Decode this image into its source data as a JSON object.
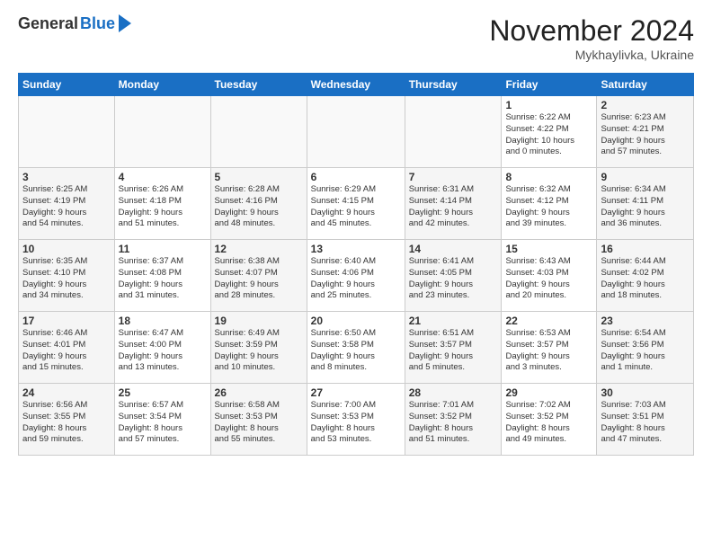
{
  "logo": {
    "general": "General",
    "blue": "Blue"
  },
  "header": {
    "title": "November 2024",
    "location": "Mykhaylivka, Ukraine"
  },
  "days": [
    "Sunday",
    "Monday",
    "Tuesday",
    "Wednesday",
    "Thursday",
    "Friday",
    "Saturday"
  ],
  "weeks": [
    [
      {
        "num": "",
        "info": ""
      },
      {
        "num": "",
        "info": ""
      },
      {
        "num": "",
        "info": ""
      },
      {
        "num": "",
        "info": ""
      },
      {
        "num": "",
        "info": ""
      },
      {
        "num": "1",
        "info": "Sunrise: 6:22 AM\nSunset: 4:22 PM\nDaylight: 10 hours\nand 0 minutes."
      },
      {
        "num": "2",
        "info": "Sunrise: 6:23 AM\nSunset: 4:21 PM\nDaylight: 9 hours\nand 57 minutes."
      }
    ],
    [
      {
        "num": "3",
        "info": "Sunrise: 6:25 AM\nSunset: 4:19 PM\nDaylight: 9 hours\nand 54 minutes."
      },
      {
        "num": "4",
        "info": "Sunrise: 6:26 AM\nSunset: 4:18 PM\nDaylight: 9 hours\nand 51 minutes."
      },
      {
        "num": "5",
        "info": "Sunrise: 6:28 AM\nSunset: 4:16 PM\nDaylight: 9 hours\nand 48 minutes."
      },
      {
        "num": "6",
        "info": "Sunrise: 6:29 AM\nSunset: 4:15 PM\nDaylight: 9 hours\nand 45 minutes."
      },
      {
        "num": "7",
        "info": "Sunrise: 6:31 AM\nSunset: 4:14 PM\nDaylight: 9 hours\nand 42 minutes."
      },
      {
        "num": "8",
        "info": "Sunrise: 6:32 AM\nSunset: 4:12 PM\nDaylight: 9 hours\nand 39 minutes."
      },
      {
        "num": "9",
        "info": "Sunrise: 6:34 AM\nSunset: 4:11 PM\nDaylight: 9 hours\nand 36 minutes."
      }
    ],
    [
      {
        "num": "10",
        "info": "Sunrise: 6:35 AM\nSunset: 4:10 PM\nDaylight: 9 hours\nand 34 minutes."
      },
      {
        "num": "11",
        "info": "Sunrise: 6:37 AM\nSunset: 4:08 PM\nDaylight: 9 hours\nand 31 minutes."
      },
      {
        "num": "12",
        "info": "Sunrise: 6:38 AM\nSunset: 4:07 PM\nDaylight: 9 hours\nand 28 minutes."
      },
      {
        "num": "13",
        "info": "Sunrise: 6:40 AM\nSunset: 4:06 PM\nDaylight: 9 hours\nand 25 minutes."
      },
      {
        "num": "14",
        "info": "Sunrise: 6:41 AM\nSunset: 4:05 PM\nDaylight: 9 hours\nand 23 minutes."
      },
      {
        "num": "15",
        "info": "Sunrise: 6:43 AM\nSunset: 4:03 PM\nDaylight: 9 hours\nand 20 minutes."
      },
      {
        "num": "16",
        "info": "Sunrise: 6:44 AM\nSunset: 4:02 PM\nDaylight: 9 hours\nand 18 minutes."
      }
    ],
    [
      {
        "num": "17",
        "info": "Sunrise: 6:46 AM\nSunset: 4:01 PM\nDaylight: 9 hours\nand 15 minutes."
      },
      {
        "num": "18",
        "info": "Sunrise: 6:47 AM\nSunset: 4:00 PM\nDaylight: 9 hours\nand 13 minutes."
      },
      {
        "num": "19",
        "info": "Sunrise: 6:49 AM\nSunset: 3:59 PM\nDaylight: 9 hours\nand 10 minutes."
      },
      {
        "num": "20",
        "info": "Sunrise: 6:50 AM\nSunset: 3:58 PM\nDaylight: 9 hours\nand 8 minutes."
      },
      {
        "num": "21",
        "info": "Sunrise: 6:51 AM\nSunset: 3:57 PM\nDaylight: 9 hours\nand 5 minutes."
      },
      {
        "num": "22",
        "info": "Sunrise: 6:53 AM\nSunset: 3:57 PM\nDaylight: 9 hours\nand 3 minutes."
      },
      {
        "num": "23",
        "info": "Sunrise: 6:54 AM\nSunset: 3:56 PM\nDaylight: 9 hours\nand 1 minute."
      }
    ],
    [
      {
        "num": "24",
        "info": "Sunrise: 6:56 AM\nSunset: 3:55 PM\nDaylight: 8 hours\nand 59 minutes."
      },
      {
        "num": "25",
        "info": "Sunrise: 6:57 AM\nSunset: 3:54 PM\nDaylight: 8 hours\nand 57 minutes."
      },
      {
        "num": "26",
        "info": "Sunrise: 6:58 AM\nSunset: 3:53 PM\nDaylight: 8 hours\nand 55 minutes."
      },
      {
        "num": "27",
        "info": "Sunrise: 7:00 AM\nSunset: 3:53 PM\nDaylight: 8 hours\nand 53 minutes."
      },
      {
        "num": "28",
        "info": "Sunrise: 7:01 AM\nSunset: 3:52 PM\nDaylight: 8 hours\nand 51 minutes."
      },
      {
        "num": "29",
        "info": "Sunrise: 7:02 AM\nSunset: 3:52 PM\nDaylight: 8 hours\nand 49 minutes."
      },
      {
        "num": "30",
        "info": "Sunrise: 7:03 AM\nSunset: 3:51 PM\nDaylight: 8 hours\nand 47 minutes."
      }
    ]
  ]
}
